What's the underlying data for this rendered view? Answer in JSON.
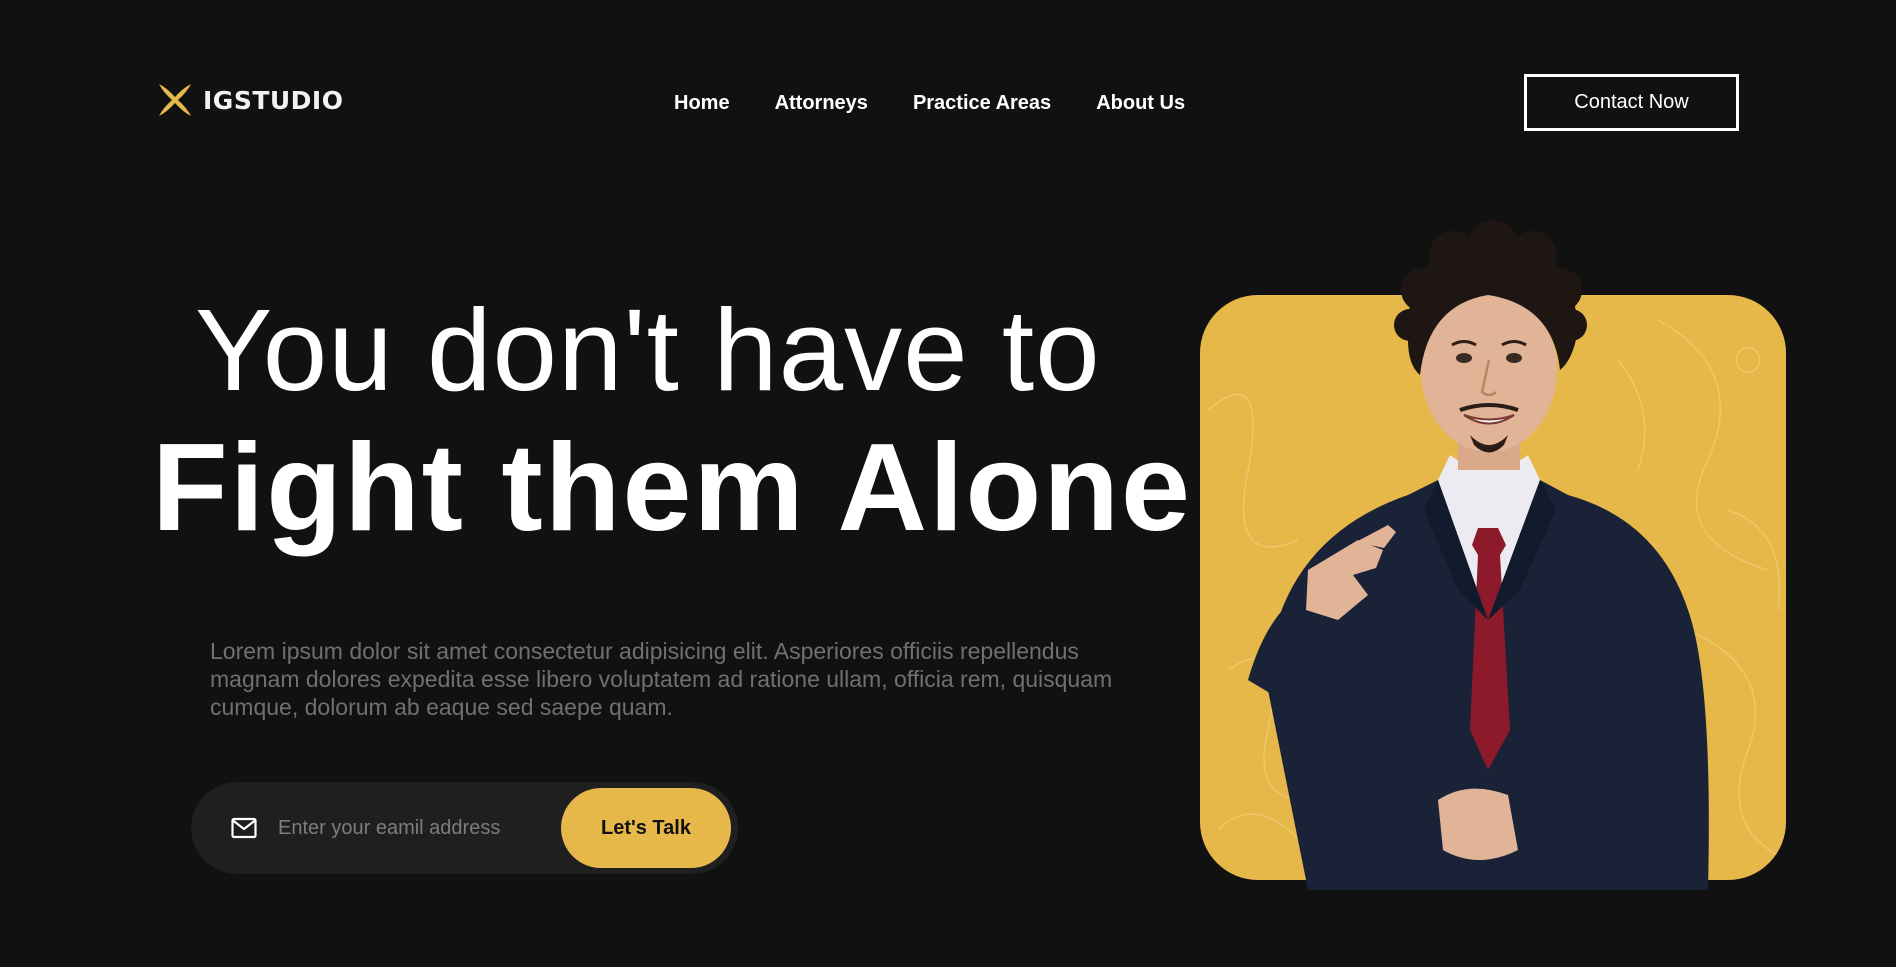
{
  "brand": {
    "logo_text": "IGSTUDIO",
    "logo_icon": "x-mark-icon",
    "accent": "#e6b84a"
  },
  "nav": {
    "items": [
      {
        "label": "Home"
      },
      {
        "label": "Attorneys"
      },
      {
        "label": "Practice Areas"
      },
      {
        "label": "About Us"
      }
    ]
  },
  "header": {
    "contact_label": "Contact Now"
  },
  "hero": {
    "headline_line1": "You don't have to",
    "headline_line2": "Fight them Alone.",
    "lead": "Lorem ipsum dolor sit amet consectetur adipisicing elit. Asperiores officiis repellendus magnam dolores expedita esse libero voluptatem ad ratione ullam, officia rem, quisquam cumque, dolorum ab eaque sed saepe quam.",
    "photo_icon": "attorney-portrait"
  },
  "subscribe": {
    "icon": "mail-icon",
    "placeholder": "Enter your eamil address",
    "value": "",
    "button_label": "Let's Talk"
  },
  "colors": {
    "background": "#111111",
    "text": "#ffffff",
    "muted_text": "#707070",
    "input_bg": "#1f1f1f",
    "photo_bg": "#e6b84a",
    "suit": "#1a2238",
    "tie": "#8c1a2a"
  }
}
